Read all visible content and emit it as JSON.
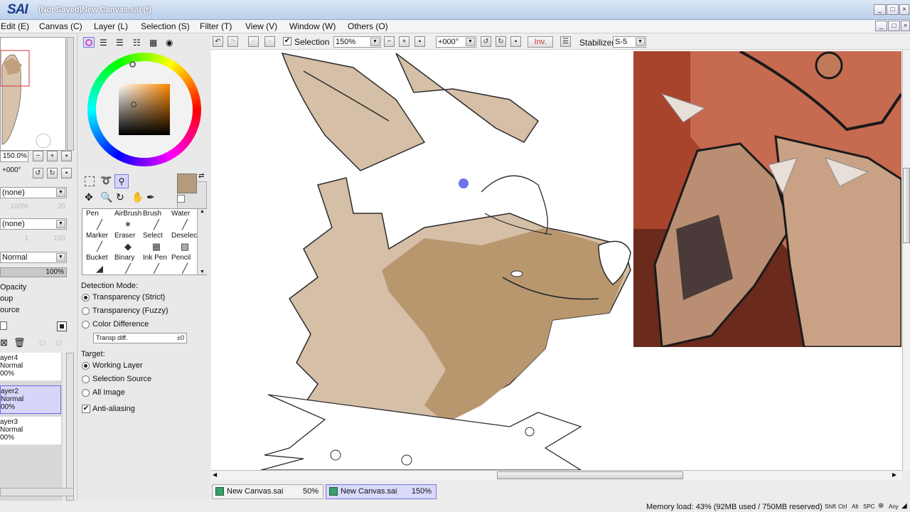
{
  "window": {
    "app_logo": "SAI",
    "title": "(Not Saved)New Canvas.sai (*)"
  },
  "menu": [
    {
      "label": "Edit (E)"
    },
    {
      "label": "Canvas (C)"
    },
    {
      "label": "Layer (L)"
    },
    {
      "label": "Selection (S)"
    },
    {
      "label": "Filter (T)"
    },
    {
      "label": "View (V)"
    },
    {
      "label": "Window (W)"
    },
    {
      "label": "Others (O)"
    }
  ],
  "navigator": {
    "zoom": "150.0%",
    "angle": "+000°"
  },
  "layer_panel": {
    "paper_texture": "(none)",
    "texture_pct_a": "100%",
    "texture_val_a": "20",
    "brush_texture": "(none)",
    "texture_val_b1": "1",
    "texture_val_b2": "100",
    "blend_mode": "Normal",
    "opacity_pct": "100%",
    "opts": [
      "Opacity",
      "oup",
      "ource"
    ],
    "layers": [
      {
        "name": "ayer4",
        "mode": "Normal",
        "opacity": "00%",
        "selected": false
      },
      {
        "name": "ayer2",
        "mode": "Normal",
        "opacity": "00%",
        "selected": true
      },
      {
        "name": "ayer3",
        "mode": "Normal",
        "opacity": "00%",
        "selected": false
      }
    ]
  },
  "color": {
    "current": "#b59a7c",
    "secondary": "#e0e0e0"
  },
  "tools": [
    {
      "label": "Pen",
      "icon": "pen-icon",
      "glyph": "╱"
    },
    {
      "label": "AirBrush",
      "icon": "airbrush-icon",
      "glyph": "✶"
    },
    {
      "label": "Brush",
      "icon": "brush-icon",
      "glyph": "╱"
    },
    {
      "label": "Water",
      "icon": "water-brush-icon",
      "glyph": "╱"
    },
    {
      "label": "Marker",
      "icon": "marker-icon",
      "glyph": "╱"
    },
    {
      "label": "Eraser",
      "icon": "eraser-icon",
      "glyph": "◆"
    },
    {
      "label": "Select",
      "icon": "select-icon",
      "glyph": "▦"
    },
    {
      "label": "Deselect",
      "icon": "deselect-icon",
      "glyph": "▧"
    },
    {
      "label": "Bucket",
      "icon": "bucket-icon",
      "glyph": "◢"
    },
    {
      "label": "Binary",
      "icon": "binary-pen-icon",
      "glyph": "╱"
    },
    {
      "label": "Ink Pen",
      "icon": "ink-pen-icon",
      "glyph": "╱"
    },
    {
      "label": "Pencil",
      "icon": "pencil-icon",
      "glyph": "╱"
    }
  ],
  "tool_options": {
    "detection_mode_label": "Detection Mode:",
    "detection_modes": [
      {
        "label": "Transparency (Strict)",
        "on": true
      },
      {
        "label": "Transparency (Fuzzy)",
        "on": false
      },
      {
        "label": "Color Difference",
        "on": false
      }
    ],
    "transp_diff_label": "Transp diff.",
    "transp_diff_value": "±0",
    "target_label": "Target:",
    "targets": [
      {
        "label": "Working Layer",
        "on": true
      },
      {
        "label": "Selection Source",
        "on": false
      },
      {
        "label": "All Image",
        "on": false
      }
    ],
    "antialias_label": "Anti-aliasing",
    "antialias_checked": "✔"
  },
  "toolbar": {
    "selection_label": "Selection",
    "selection_checked": "✔",
    "zoom": "150%",
    "rotation": "+000°",
    "invert_label": "Inv.",
    "stabilizer_label": "Stabilizer",
    "stabilizer_value": "S-5"
  },
  "tabs": [
    {
      "label": "New Canvas.sai",
      "zoom": "50%",
      "active": false
    },
    {
      "label": "New Canvas.sai",
      "zoom": "150%",
      "active": true
    }
  ],
  "status": {
    "memory": "Memory load: 43% (92MB used / 750MB reserved)",
    "keys": [
      "Shift",
      "Ctrl",
      "Alt",
      "SPC",
      "⊕",
      "Any"
    ]
  },
  "colors": {
    "fur_light": "#d6bfa7",
    "fur_dark": "#b8976f",
    "outline": "#2b2b2b",
    "ref_bg": "#a8442c"
  }
}
